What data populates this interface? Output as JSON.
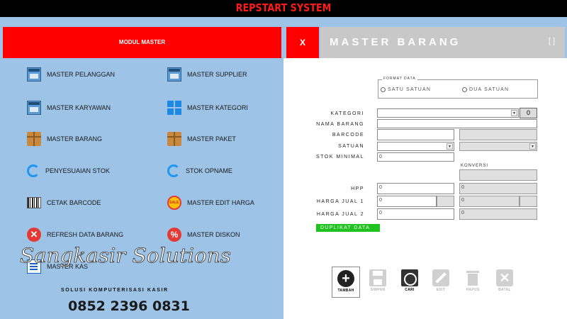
{
  "app": {
    "title": "REPSTART SYSTEM"
  },
  "left": {
    "header": "MODUL MASTER",
    "items": [
      {
        "label": "MASTER PELANGGAN",
        "icon": "window-icon"
      },
      {
        "label": "MASTER SUPPLIER",
        "icon": "window-icon"
      },
      {
        "label": "MASTER KARYAWAN",
        "icon": "window-icon"
      },
      {
        "label": "MASTER KATEGORI",
        "icon": "tiles-icon"
      },
      {
        "label": "MASTER BARANG",
        "icon": "box-icon"
      },
      {
        "label": "MASTER PAKET",
        "icon": "boxes-icon"
      },
      {
        "label": "PENYESUAIAN STOK",
        "icon": "sync-icon"
      },
      {
        "label": "STOK OPNAME",
        "icon": "sync-icon"
      },
      {
        "label": "CETAK BARCODE",
        "icon": "barcode-icon"
      },
      {
        "label": "MASTER EDIT HARGA",
        "icon": "sale-badge-icon"
      },
      {
        "label": "REFRESH DATA BARANG",
        "icon": "x-circle-icon"
      },
      {
        "label": "MASTER DISKON",
        "icon": "percent-icon"
      },
      {
        "label": "MASTER KAS",
        "icon": "note-icon"
      }
    ]
  },
  "brand": {
    "script": "Sangkasir Solutions",
    "subtitle": "SOLUSI KOMPUTERISASI KASIR",
    "phone": "0852 2396 0831"
  },
  "right": {
    "close_label": "X",
    "title": "MASTER BARANG",
    "window_icon_text": "[ ]",
    "format": {
      "legend": "FORMAT DATA",
      "option1": "SATU SATUAN",
      "option2": "DUA SATUAN"
    },
    "labels": {
      "kategori": "KATEGORI",
      "nama_barang": "NAMA BARANG",
      "barcode": "BARCODE",
      "satuan": "SATUAN",
      "stok_minimal": "STOK MINIMAL",
      "konversi": "KONVERSI",
      "hpp": "HPP",
      "harga_jual1": "HARGA JUAL 1",
      "harga_jual2": "HARGA JUAL 2"
    },
    "values": {
      "kategori_btn": "0",
      "stok_minimal": "0",
      "hpp": "0",
      "hpp2": "0",
      "harga_jual1": "0",
      "harga_jual1b": "0",
      "harga_jual2": "0",
      "harga_jual2b": "0"
    },
    "duplikat_label": "DUPLIKAT DATA",
    "actions": [
      {
        "label": "TAMBAH",
        "enabled": true
      },
      {
        "label": "SIMPAN",
        "enabled": false
      },
      {
        "label": "CARI",
        "enabled": true
      },
      {
        "label": "EDIT",
        "enabled": false
      },
      {
        "label": "HAPUS",
        "enabled": false
      },
      {
        "label": "BATAL",
        "enabled": false
      }
    ]
  },
  "colors": {
    "accent_red": "#ff0000",
    "panel_blue": "#9dc3e6",
    "duplikat_green": "#1fc21f"
  }
}
